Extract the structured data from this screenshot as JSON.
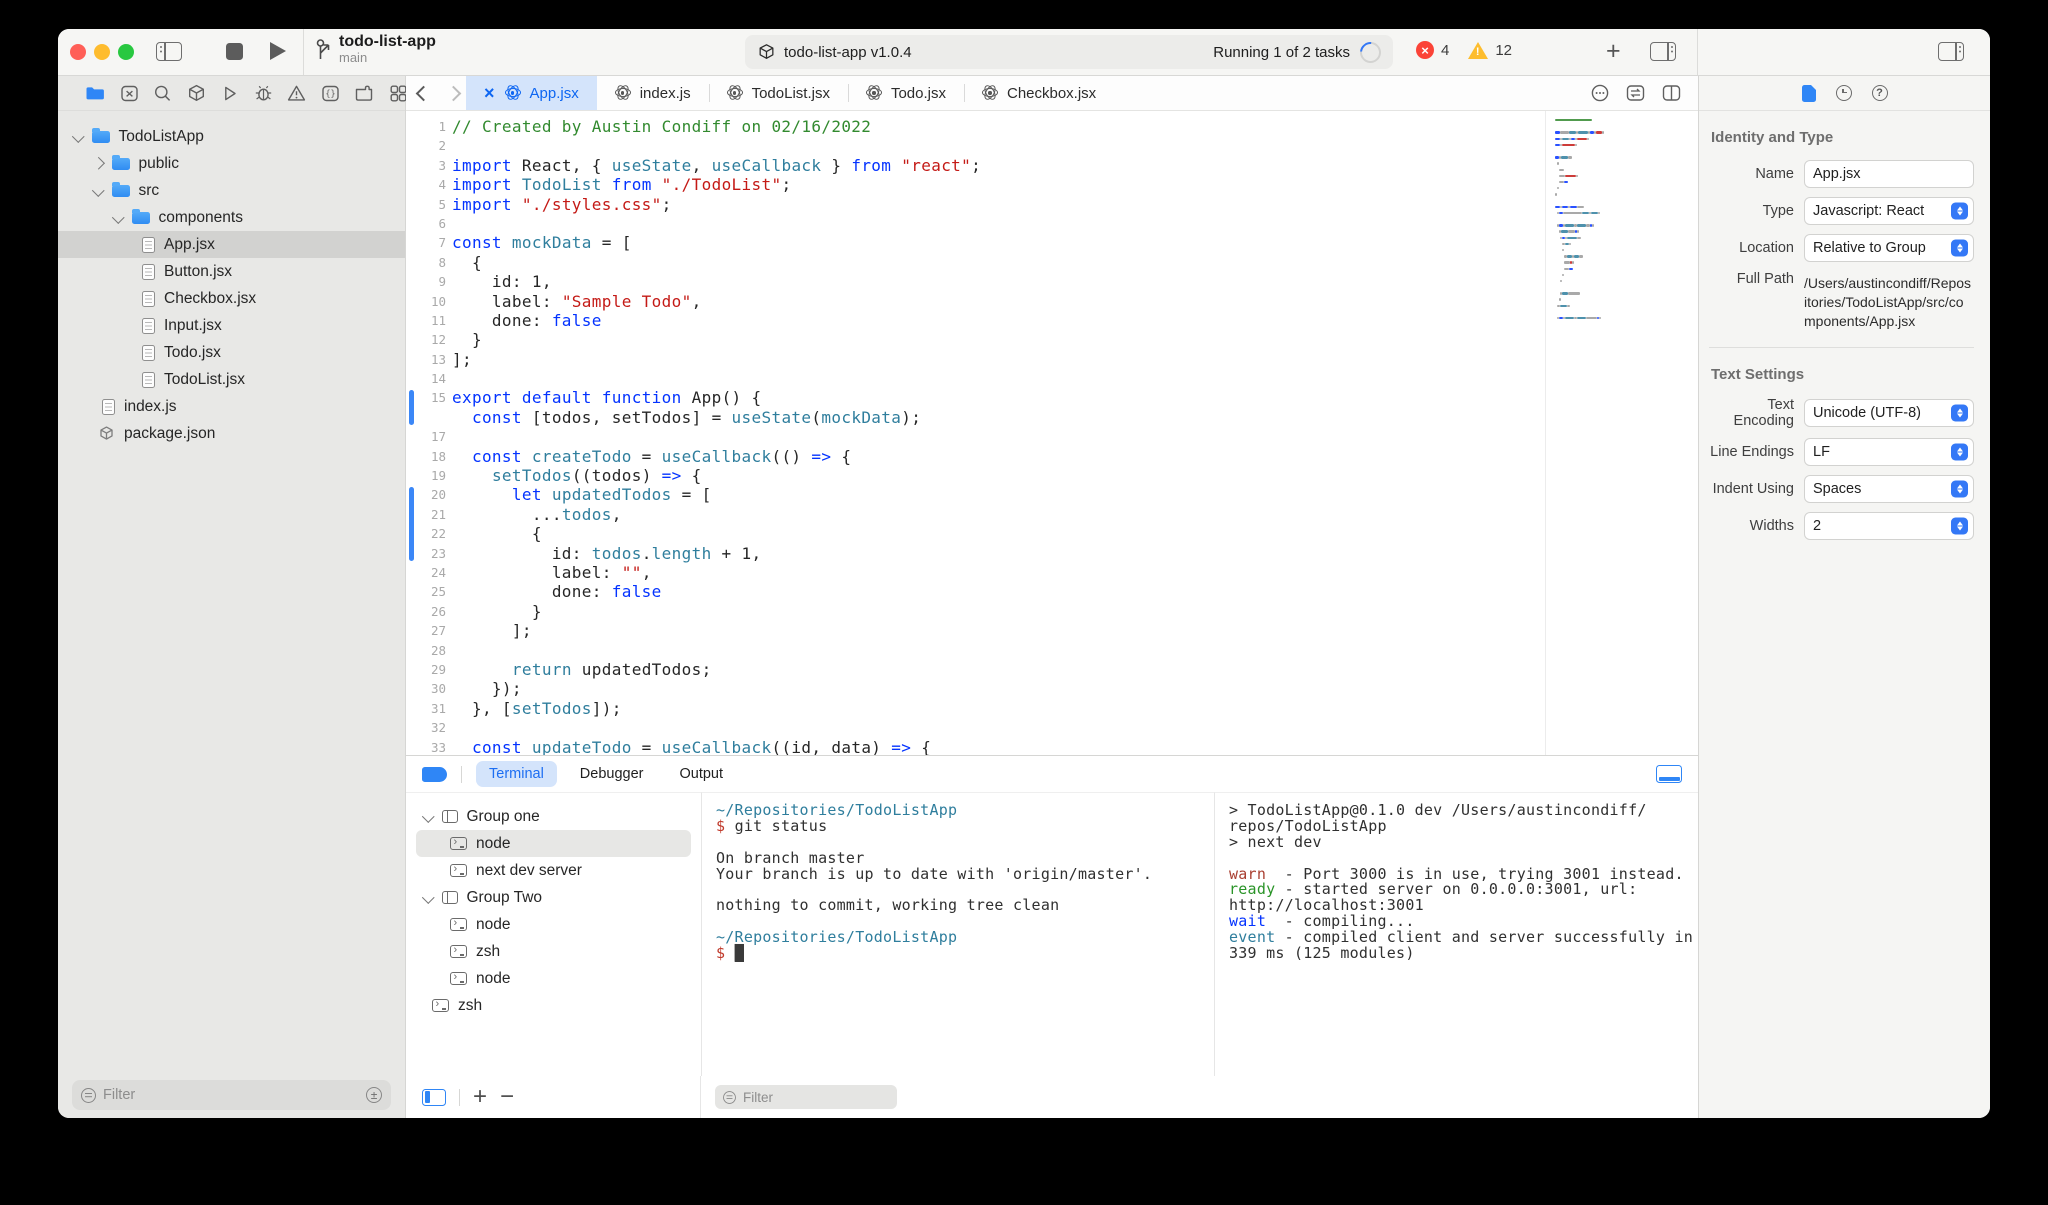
{
  "toolbar": {
    "project": {
      "name": "todo-list-app",
      "branch": "main"
    },
    "task_pill": {
      "target": "todo-list-app v1.0.4",
      "status": "Running 1 of 2 tasks"
    },
    "issues": {
      "errors": "4",
      "warnings": "12"
    }
  },
  "navigator": {
    "filter_placeholder": "Filter"
  },
  "file_tree": {
    "items": [
      {
        "label": "TodoListApp",
        "kind": "folder",
        "depth": 0,
        "expanded": true
      },
      {
        "label": "public",
        "kind": "folder",
        "depth": 1,
        "expanded": false
      },
      {
        "label": "src",
        "kind": "folder",
        "depth": 1,
        "expanded": true
      },
      {
        "label": "components",
        "kind": "folder",
        "depth": 2,
        "expanded": true
      },
      {
        "label": "App.jsx",
        "kind": "file",
        "depth": 3,
        "selected": true
      },
      {
        "label": "Button.jsx",
        "kind": "file",
        "depth": 3
      },
      {
        "label": "Checkbox.jsx",
        "kind": "file",
        "depth": 3
      },
      {
        "label": "Input.jsx",
        "kind": "file",
        "depth": 3
      },
      {
        "label": "Todo.jsx",
        "kind": "file",
        "depth": 3
      },
      {
        "label": "TodoList.jsx",
        "kind": "file",
        "depth": 3
      },
      {
        "label": "index.js",
        "kind": "file",
        "depth": 1
      },
      {
        "label": "package.json",
        "kind": "package",
        "depth": 1
      }
    ]
  },
  "tabs": [
    {
      "label": "App.jsx",
      "active": true
    },
    {
      "label": "index.js"
    },
    {
      "label": "TodoList.jsx"
    },
    {
      "label": "Todo.jsx"
    },
    {
      "label": "Checkbox.jsx"
    }
  ],
  "editor": {
    "change_bars": [
      {
        "from": 15,
        "to": 16
      },
      {
        "from": 20,
        "to": 23
      }
    ],
    "lines": [
      {
        "n": "1",
        "tk": [
          [
            "cmt",
            "// Created by Austin Condiff on 02/16/2022"
          ]
        ]
      },
      {
        "n": "2",
        "tk": []
      },
      {
        "n": "3",
        "tk": [
          [
            "kw",
            "import"
          ],
          [
            "pl",
            " React, { "
          ],
          [
            "id",
            "useState"
          ],
          [
            "pl",
            ", "
          ],
          [
            "id",
            "useCallback"
          ],
          [
            "pl",
            " } "
          ],
          [
            "kw",
            "from"
          ],
          [
            "pl",
            " "
          ],
          [
            "str",
            "\"react\""
          ],
          [
            "pl",
            ";"
          ]
        ]
      },
      {
        "n": "4",
        "tk": [
          [
            "kw",
            "import"
          ],
          [
            "pl",
            " "
          ],
          [
            "id",
            "TodoList"
          ],
          [
            "pl",
            " "
          ],
          [
            "kw",
            "from"
          ],
          [
            "pl",
            " "
          ],
          [
            "str",
            "\"./TodoList\""
          ],
          [
            "pl",
            ";"
          ]
        ]
      },
      {
        "n": "5",
        "tk": [
          [
            "kw",
            "import"
          ],
          [
            "pl",
            " "
          ],
          [
            "str",
            "\"./styles.css\""
          ],
          [
            "pl",
            ";"
          ]
        ]
      },
      {
        "n": "6",
        "tk": []
      },
      {
        "n": "7",
        "tk": [
          [
            "kw",
            "const"
          ],
          [
            "pl",
            " "
          ],
          [
            "id",
            "mockData"
          ],
          [
            "pl",
            " = ["
          ]
        ]
      },
      {
        "n": "8",
        "tk": [
          [
            "pl",
            "  {"
          ]
        ]
      },
      {
        "n": "9",
        "tk": [
          [
            "pl",
            "    id: 1,"
          ]
        ]
      },
      {
        "n": "10",
        "tk": [
          [
            "pl",
            "    label: "
          ],
          [
            "str",
            "\"Sample Todo\""
          ],
          [
            "pl",
            ","
          ]
        ]
      },
      {
        "n": "11",
        "tk": [
          [
            "pl",
            "    done: "
          ],
          [
            "kw",
            "false"
          ]
        ]
      },
      {
        "n": "12",
        "tk": [
          [
            "pl",
            "  }"
          ]
        ]
      },
      {
        "n": "13",
        "tk": [
          [
            "pl",
            "];"
          ]
        ]
      },
      {
        "n": "14",
        "tk": []
      },
      {
        "n": "15",
        "tk": [
          [
            "kw",
            "export"
          ],
          [
            "pl",
            " "
          ],
          [
            "kw",
            "default"
          ],
          [
            "pl",
            " "
          ],
          [
            "kw",
            "function"
          ],
          [
            "pl",
            " App() {"
          ]
        ]
      },
      {
        "n": "",
        "tk": [
          [
            "pl",
            "  "
          ],
          [
            "kw",
            "const"
          ],
          [
            "pl",
            " [todos, setTodos] = "
          ],
          [
            "id",
            "useState"
          ],
          [
            "pl",
            "("
          ],
          [
            "id",
            "mockData"
          ],
          [
            "pl",
            ");"
          ]
        ]
      },
      {
        "n": "17",
        "tk": []
      },
      {
        "n": "18",
        "tk": [
          [
            "pl",
            "  "
          ],
          [
            "kw",
            "const"
          ],
          [
            "pl",
            " "
          ],
          [
            "id",
            "createTodo"
          ],
          [
            "pl",
            " = "
          ],
          [
            "id",
            "useCallback"
          ],
          [
            "pl",
            "(() "
          ],
          [
            "kw",
            "=>"
          ],
          [
            "pl",
            " {"
          ]
        ]
      },
      {
        "n": "19",
        "tk": [
          [
            "pl",
            "    "
          ],
          [
            "id",
            "setTodos"
          ],
          [
            "pl",
            "((todos) "
          ],
          [
            "kw",
            "=>"
          ],
          [
            "pl",
            " {"
          ]
        ]
      },
      {
        "n": "20",
        "tk": [
          [
            "pl",
            "      "
          ],
          [
            "kw",
            "let"
          ],
          [
            "pl",
            " "
          ],
          [
            "id",
            "updatedTodos"
          ],
          [
            "pl",
            " = ["
          ]
        ]
      },
      {
        "n": "21",
        "tk": [
          [
            "pl",
            "        ..."
          ],
          [
            "id",
            "todos"
          ],
          [
            "pl",
            ","
          ]
        ]
      },
      {
        "n": "22",
        "tk": [
          [
            "pl",
            "        {"
          ]
        ]
      },
      {
        "n": "23",
        "tk": [
          [
            "pl",
            "          id: "
          ],
          [
            "id",
            "todos"
          ],
          [
            "pl",
            "."
          ],
          [
            "id",
            "length"
          ],
          [
            "pl",
            " + 1,"
          ]
        ]
      },
      {
        "n": "24",
        "tk": [
          [
            "pl",
            "          label: "
          ],
          [
            "str",
            "\"\""
          ],
          [
            "pl",
            ","
          ]
        ]
      },
      {
        "n": "25",
        "tk": [
          [
            "pl",
            "          done: "
          ],
          [
            "kw",
            "false"
          ]
        ]
      },
      {
        "n": "26",
        "tk": [
          [
            "pl",
            "        }"
          ]
        ]
      },
      {
        "n": "27",
        "tk": [
          [
            "pl",
            "      ];"
          ]
        ]
      },
      {
        "n": "28",
        "tk": []
      },
      {
        "n": "29",
        "tk": [
          [
            "pl",
            "      "
          ],
          [
            "id",
            "return"
          ],
          [
            "pl",
            " updatedTodos;"
          ]
        ]
      },
      {
        "n": "30",
        "tk": [
          [
            "pl",
            "    });"
          ]
        ]
      },
      {
        "n": "31",
        "tk": [
          [
            "pl",
            "  }, ["
          ],
          [
            "id",
            "setTodos"
          ],
          [
            "pl",
            "]);"
          ]
        ]
      },
      {
        "n": "32",
        "tk": []
      },
      {
        "n": "33",
        "tk": [
          [
            "pl",
            "  "
          ],
          [
            "kw",
            "const"
          ],
          [
            "pl",
            " "
          ],
          [
            "id",
            "updateTodo"
          ],
          [
            "pl",
            " = "
          ],
          [
            "id",
            "useCallback"
          ],
          [
            "pl",
            "((id, data) "
          ],
          [
            "kw",
            "=>"
          ],
          [
            "pl",
            " {"
          ]
        ]
      }
    ]
  },
  "inspector": {
    "sections": [
      {
        "title": "Identity and Type",
        "fields": [
          {
            "label": "Name",
            "value": "App.jsx",
            "control": "input"
          },
          {
            "label": "Type",
            "value": "Javascript: React",
            "control": "select"
          },
          {
            "label": "Location",
            "value": "Relative to Group",
            "control": "select"
          },
          {
            "label": "Full Path",
            "value": "/Users/austincondiff/Repositories/TodoListApp/src/components/App.jsx",
            "control": "static"
          }
        ]
      },
      {
        "title": "Text Settings",
        "fields": [
          {
            "label": "Text Encoding",
            "value": "Unicode (UTF-8)",
            "control": "select"
          },
          {
            "label": "Line Endings",
            "value": "LF",
            "control": "select"
          },
          {
            "label": "Indent Using",
            "value": "Spaces",
            "control": "select"
          },
          {
            "label": "Widths",
            "value": "2",
            "control": "select"
          }
        ]
      }
    ]
  },
  "drawer": {
    "tabs": [
      {
        "label": "Terminal",
        "active": true
      },
      {
        "label": "Debugger"
      },
      {
        "label": "Output"
      }
    ],
    "filter_placeholder": "Filter",
    "groups": [
      {
        "label": "Group one",
        "kind": "group",
        "indent": 0,
        "expanded": true
      },
      {
        "label": "node",
        "kind": "term",
        "indent": 1,
        "selected": true
      },
      {
        "label": "next dev server",
        "kind": "term",
        "indent": 1
      },
      {
        "label": "Group Two",
        "kind": "group",
        "indent": 0,
        "expanded": true
      },
      {
        "label": "node",
        "kind": "term",
        "indent": 1
      },
      {
        "label": "zsh",
        "kind": "term",
        "indent": 1
      },
      {
        "label": "node",
        "kind": "term",
        "indent": 1
      },
      {
        "label": "zsh",
        "kind": "term",
        "indent": 0
      }
    ],
    "terminal_left": [
      [
        [
          "path",
          "~/Repositories/TodoListApp"
        ]
      ],
      [
        [
          "prompt",
          "$ "
        ],
        [
          "cmd",
          "git status"
        ]
      ],
      [],
      [
        [
          "out",
          "On branch master"
        ]
      ],
      [
        [
          "out",
          "Your branch is up to date with 'origin/master'."
        ]
      ],
      [],
      [
        [
          "out",
          "nothing to commit, working tree clean"
        ]
      ],
      [],
      [
        [
          "path",
          "~/Repositories/TodoListApp"
        ]
      ],
      [
        [
          "prompt",
          "$ "
        ],
        [
          "cursor",
          "█"
        ]
      ]
    ],
    "terminal_right": [
      [
        [
          "out",
          "> TodoListApp@0.1.0 dev /Users/austincondiff/"
        ]
      ],
      [
        [
          "out",
          "repos/TodoListApp"
        ]
      ],
      [
        [
          "out",
          "> next dev"
        ]
      ],
      [],
      [
        [
          "warn",
          "warn"
        ],
        [
          "out",
          "  - Port 3000 is in use, trying 3001 instead."
        ]
      ],
      [
        [
          "ready",
          "ready"
        ],
        [
          "out",
          " - started server on 0.0.0.0:3001, url:"
        ]
      ],
      [
        [
          "out",
          "http://localhost:3001"
        ]
      ],
      [
        [
          "wait",
          "wait"
        ],
        [
          "out",
          "  - compiling..."
        ]
      ],
      [
        [
          "event",
          "event"
        ],
        [
          "out",
          " - compiled client and server successfully in"
        ]
      ],
      [
        [
          "out",
          "339 ms (125 modules)"
        ]
      ]
    ]
  },
  "colors": {
    "accent": "#2f86f6",
    "error": "#fb4337",
    "warning": "#fdbd2e",
    "change_bar": "#3b87f7",
    "syntax": {
      "pl": "#262626",
      "kw": "#0433ff",
      "id": "#2f7e9d",
      "str": "#c41a16",
      "cmt": "#328a2f"
    },
    "terminal": {
      "path": "#2f7e9d",
      "prompt": "#c03a2b",
      "cmd": "#303030",
      "out": "#303030",
      "warn": "#a93f31",
      "ready": "#2a9428",
      "wait": "#0433ff",
      "event": "#2f7e9d",
      "cursor": "#3a3a3a"
    }
  }
}
